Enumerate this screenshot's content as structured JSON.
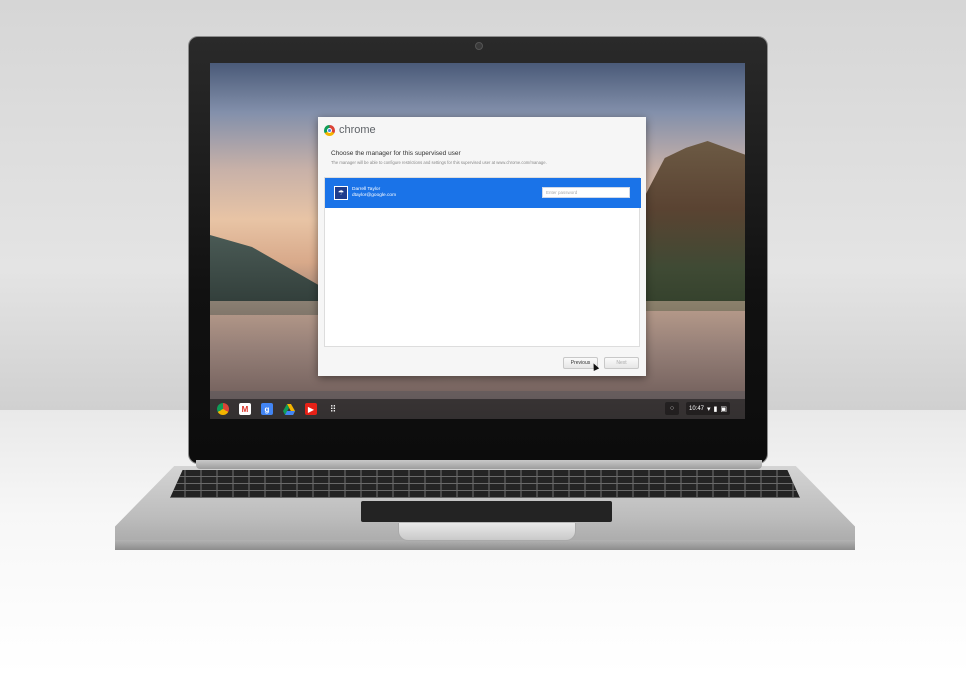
{
  "dialog": {
    "brand": "chrome",
    "title": "Choose the manager for this supervised user",
    "description": "The manager will be able to configure restrictions and settings for this supervised user at www.chrome.com/manage.",
    "user": {
      "name": "Darrell Taylor",
      "email": "dtaylor@google.com"
    },
    "password_placeholder": "Enter password",
    "buttons": {
      "previous": "Previous",
      "next": "Next"
    }
  },
  "shelf": {
    "apps": [
      "chrome-icon",
      "gmail-icon",
      "google-search-icon",
      "google-drive-icon",
      "youtube-icon",
      "app-launcher-icon"
    ],
    "status": {
      "time": "10:47"
    }
  },
  "colors": {
    "selection_blue": "#1a73e8",
    "dialog_bg": "#f6f6f6"
  }
}
